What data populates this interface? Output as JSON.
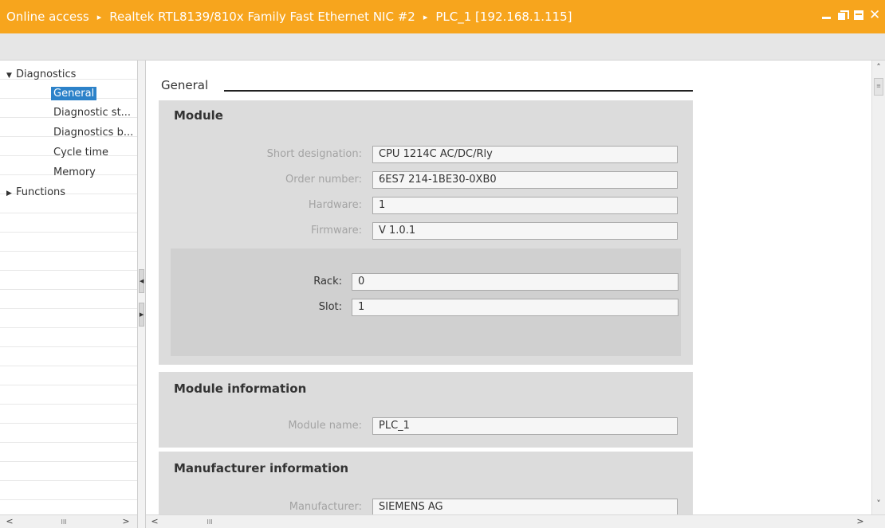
{
  "window": {
    "breadcrumb": [
      "Online access",
      "Realtek RTL8139/810x Family Fast Ethernet NIC #2",
      "PLC_1 [192.168.1.115]"
    ],
    "separator": "▸",
    "buttons": {
      "minimize": "",
      "restore": "",
      "maximize": "",
      "close": "✕"
    }
  },
  "tree": {
    "items": [
      {
        "label": "Diagnostics",
        "expanded": true,
        "arrow": "▼"
      },
      {
        "label": "General",
        "selected": true
      },
      {
        "label": "Diagnostic st..."
      },
      {
        "label": "Diagnostics b..."
      },
      {
        "label": "Cycle time"
      },
      {
        "label": "Memory"
      },
      {
        "label": "Functions",
        "expanded": false,
        "arrow": "▶"
      }
    ],
    "scroll_left": "<",
    "scroll_right": ">",
    "scroll_grip": "III"
  },
  "splitter": {
    "collapse_left": "◀",
    "expand_right": "▶"
  },
  "main": {
    "header": "General",
    "module": {
      "title": "Module",
      "short_designation_label": "Short designation:",
      "short_designation": "CPU 1214C AC/DC/Rly",
      "order_number_label": "Order number:",
      "order_number": "6ES7 214-1BE30-0XB0",
      "hardware_label": "Hardware:",
      "hardware": "1",
      "firmware_label": "Firmware:",
      "firmware": "V 1.0.1",
      "rack_label": "Rack:",
      "rack": "0",
      "slot_label": "Slot:",
      "slot": "1"
    },
    "module_information": {
      "title": "Module information",
      "module_name_label": "Module name:",
      "module_name": "PLC_1"
    },
    "manufacturer_information": {
      "title": "Manufacturer information",
      "manufacturer_label": "Manufacturer:",
      "manufacturer": "SIEMENS AG"
    },
    "vscroll_up": "˄",
    "vscroll_down": "˅",
    "vscroll_grip": "≡",
    "hscroll_left": "<",
    "hscroll_right": ">",
    "hscroll_grip": "III"
  }
}
